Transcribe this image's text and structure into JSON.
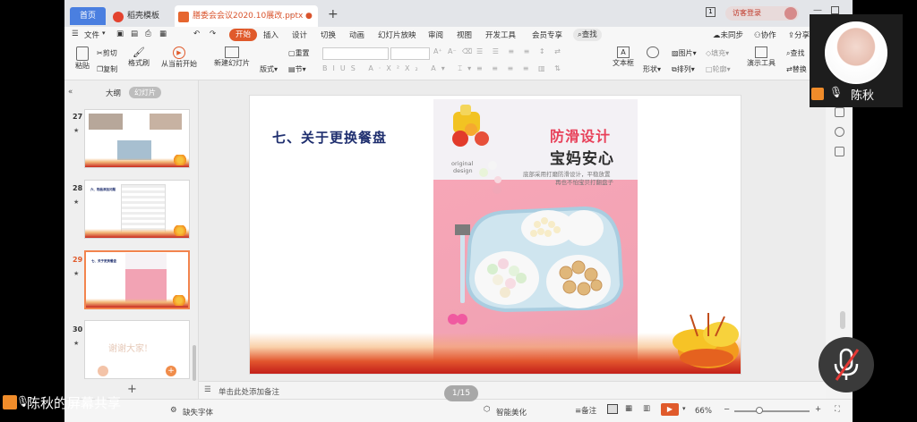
{
  "tabs": {
    "home": "首页",
    "daoke": "稻壳模板",
    "file": "膳委会会议2020.10展改.pptx"
  },
  "visitor_login": "访客登录",
  "menu": {
    "file": "文件",
    "items": [
      "开始",
      "插入",
      "设计",
      "切换",
      "动画",
      "幻灯片放映",
      "审阅",
      "视图",
      "开发工具",
      "会员专享"
    ],
    "search": "查找",
    "sync": "未同步",
    "collab": "协作",
    "share": "分享"
  },
  "ribbon": {
    "paste": "粘贴",
    "cut": "剪切",
    "copy": "复制",
    "format_painter": "格式刷",
    "play_from_current": "从当前开始",
    "new_slide": "新建幻灯片",
    "layout": "版式",
    "section": "节",
    "reset": "重置",
    "textbox": "文本框",
    "shape": "形状",
    "arrange": "排列",
    "picture": "图片",
    "fill": "填充",
    "outline": "轮廓",
    "presentation_tools": "演示工具",
    "find": "查找",
    "replace": "替换"
  },
  "left_panel": {
    "outline": "大纲",
    "slides": "幻灯片",
    "thumbs": [
      {
        "num": "27",
        "caption": ""
      },
      {
        "num": "28",
        "caption": "六、物品添加问题"
      },
      {
        "num": "29",
        "caption": "七、关于更换餐盘"
      },
      {
        "num": "30",
        "caption": "谢谢大家!"
      }
    ],
    "add": "+"
  },
  "slide": {
    "title": "七、关于更换餐盘",
    "photo_title": "防滑设计",
    "photo_subtitle": "宝妈安心",
    "photo_line1": "底部采用打磨防滑设计，平稳放置",
    "photo_line2": "再也不怕宝贝打翻盘子",
    "photo_tag1": "original",
    "photo_tag2": "design"
  },
  "notes_placeholder": "单击此处添加备注",
  "page_indicator": "1/15",
  "status": {
    "missing_font": "缺失字体",
    "smart_beautify": "智能美化",
    "notes": "备注",
    "zoom": "66%"
  },
  "video": {
    "name": "陈秋"
  },
  "screen_share_label": "陈秋的屏幕共享",
  "colors": {
    "accent": "#e05a2b",
    "title_navy": "#1f2f6f",
    "tab_blue": "#4a7fe0"
  }
}
